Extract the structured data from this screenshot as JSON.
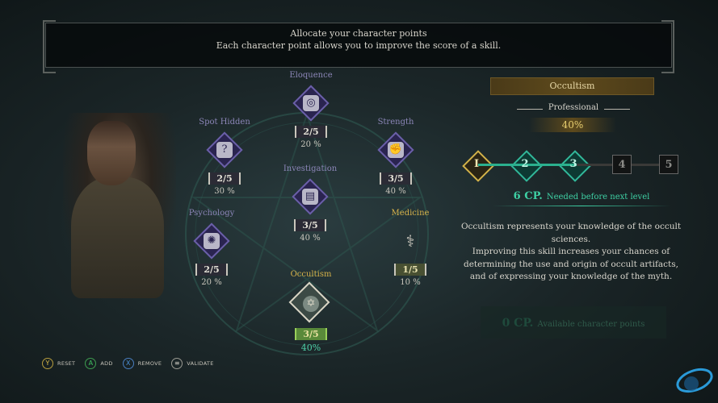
{
  "header": {
    "line1": "Allocate your character points",
    "line2": "Each character point allows you to improve the score of a skill."
  },
  "skills": [
    {
      "name": "Eloquence",
      "score": "2/5",
      "pct": "20 %",
      "icon": "coins-icon"
    },
    {
      "name": "Spot Hidden",
      "score": "2/5",
      "pct": "30 %",
      "icon": "question-icon"
    },
    {
      "name": "Strength",
      "score": "3/5",
      "pct": "40 %",
      "icon": "fist-icon"
    },
    {
      "name": "Investigation",
      "score": "3/5",
      "pct": "40 %",
      "icon": "document-icon"
    },
    {
      "name": "Psychology",
      "score": "2/5",
      "pct": "20 %",
      "icon": "brain-icon"
    },
    {
      "name": "Medicine",
      "score": "1/5",
      "pct": "10 %",
      "icon": "caduceus-icon"
    },
    {
      "name": "Occultism",
      "score": "3/5",
      "pct": "40%",
      "icon": "occult-sigil-icon"
    }
  ],
  "detail": {
    "title": "Occultism",
    "rank": "Professional",
    "pct": "40%",
    "levels": [
      "I",
      "2",
      "3",
      "4",
      "5"
    ],
    "cp_needed_value": "6 CP.",
    "cp_needed_label": "Needed before next level",
    "description_1": "Occultism represents your knowledge of the occult sciences.",
    "description_2": "Improving this skill increases your chances of determining the use and origin of occult artifacts, and of expressing your knowledge of the myth.",
    "cp_available_value": "0 CP.",
    "cp_available_label": "Available character points"
  },
  "controls": [
    {
      "button": "Y",
      "label": "RESET"
    },
    {
      "button": "A",
      "label": "ADD"
    },
    {
      "button": "X",
      "label": "REMOVE"
    },
    {
      "button": "≡",
      "label": "VALIDATE"
    }
  ],
  "colors": {
    "accent_teal": "#3ed0a4",
    "accent_gold": "#d2b24a",
    "skill_purple": "#6a5fa8"
  }
}
